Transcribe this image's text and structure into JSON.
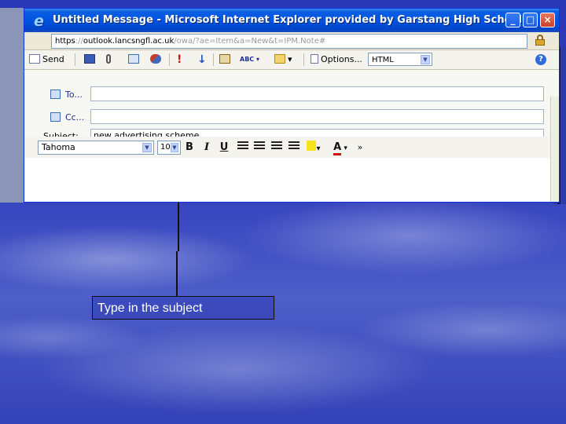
{
  "window": {
    "title": "Untitled Message - Microsoft Internet Explorer provided by Garstang High School",
    "controls": {
      "minimize": "_",
      "maximize": "□",
      "close": "×"
    }
  },
  "address_bar": {
    "protocol": "https",
    "separator": "://",
    "host": "outlook.lancsngfl.ac.uk",
    "path": "/owa/?ae=Item&a=New&t=IPM.Note#"
  },
  "toolbar": {
    "send_label": "Send",
    "options_label": "Options...",
    "format_value": "HTML",
    "spell_badge": "ABC",
    "help_glyph": "?"
  },
  "recipients": {
    "to_label": "To...",
    "cc_label": "Cc...",
    "subject_label": "Subject:",
    "to_value": "",
    "cc_value": "",
    "subject_value": "new advertising scheme"
  },
  "formatting": {
    "font": "Tahoma",
    "size": "10",
    "bold": "B",
    "italic": "I",
    "underline": "U",
    "font_color": "A",
    "more": "»"
  },
  "annotation": {
    "text": "Type in the subject"
  },
  "colors": {
    "titlebar": "#0054e3",
    "slide_background": "#3442be",
    "callout_border": "#111111"
  }
}
